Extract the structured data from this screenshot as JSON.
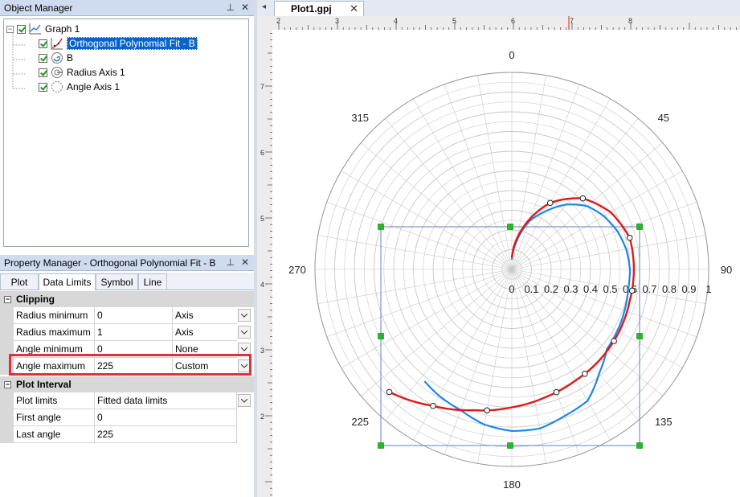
{
  "object_manager": {
    "title": "Object Manager",
    "tree": [
      {
        "label": "Graph 1",
        "icon": "graph-icon"
      },
      {
        "label": "Orthogonal Polynomial Fit - B",
        "icon": "fit-curve-icon",
        "selected": true
      },
      {
        "label": "B",
        "icon": "polar-plot-icon"
      },
      {
        "label": "Radius Axis 1",
        "icon": "radius-axis-icon"
      },
      {
        "label": "Angle Axis 1",
        "icon": "angle-axis-icon"
      }
    ]
  },
  "property_manager": {
    "title": "Property Manager - Orthogonal Polynomial Fit - B",
    "tabs": [
      "Plot",
      "Data Limits",
      "Symbol",
      "Line"
    ],
    "active_tab": "Data Limits",
    "sections": [
      {
        "name": "Clipping",
        "rows": [
          {
            "label": "Radius minimum",
            "value": "0",
            "mode": "Axis"
          },
          {
            "label": "Radius maximum",
            "value": "1",
            "mode": "Axis"
          },
          {
            "label": "Angle minimum",
            "value": "0",
            "mode": "None"
          },
          {
            "label": "Angle maximum",
            "value": "225",
            "mode": "Custom"
          }
        ]
      },
      {
        "name": "Plot Interval",
        "rows": [
          {
            "label": "Plot limits",
            "value": "Fitted data limits"
          },
          {
            "label": "First angle",
            "value": "0"
          },
          {
            "label": "Last angle",
            "value": "225"
          }
        ]
      }
    ]
  },
  "document": {
    "tab_label": "Plot1.gpj",
    "ruler_top_labels": [
      "2",
      "3",
      "4",
      "5",
      "6",
      "7",
      "8"
    ],
    "ruler_left_labels": [
      "7",
      "6",
      "5",
      "4",
      "3",
      "2"
    ]
  },
  "colors": {
    "fit_line": "#e01818",
    "data_line": "#1f86e8",
    "selection_box": "#5b84c4",
    "handle": "#22bb22",
    "grid": "#c8c8c8"
  },
  "chart_data": {
    "type": "polar",
    "angle_labels": [
      "0",
      "45",
      "90",
      "135",
      "180",
      "225",
      "270",
      "315"
    ],
    "radius_labels": [
      "0",
      "0.1",
      "0.2",
      "0.3",
      "0.4",
      "0.5",
      "0.6",
      "0.7",
      "0.8",
      "0.9",
      "1"
    ],
    "radius_range": [
      0,
      1
    ],
    "angle_range_degrees": [
      0,
      360
    ],
    "angle_direction": "clockwise",
    "zero_angle": "top",
    "grid": true,
    "series": [
      {
        "kind": "fit",
        "angle_deg": [
          0,
          15,
          30,
          45,
          60,
          75,
          90,
          105,
          120,
          135,
          150,
          165,
          180,
          195,
          210,
          225
        ],
        "radius": [
          0.06,
          0.22,
          0.39,
          0.51,
          0.58,
          0.62,
          0.62,
          0.62,
          0.63,
          0.64,
          0.65,
          0.67,
          0.7,
          0.74,
          0.8,
          0.88
        ]
      },
      {
        "kind": "data",
        "angle_deg": [
          0,
          10,
          20,
          30,
          40,
          50,
          60,
          70,
          80,
          90,
          100,
          110,
          120,
          130,
          140,
          150,
          160,
          170,
          180,
          190,
          200,
          210,
          218
        ],
        "radius": [
          0.05,
          0.15,
          0.26,
          0.34,
          0.43,
          0.5,
          0.54,
          0.57,
          0.59,
          0.6,
          0.6,
          0.61,
          0.62,
          0.63,
          0.69,
          0.77,
          0.79,
          0.82,
          0.82,
          0.8,
          0.76,
          0.74,
          0.72
        ]
      }
    ],
    "fit_markers_angle_deg": [
      30,
      45,
      75,
      100,
      125,
      145,
      160,
      190,
      210,
      225
    ]
  }
}
